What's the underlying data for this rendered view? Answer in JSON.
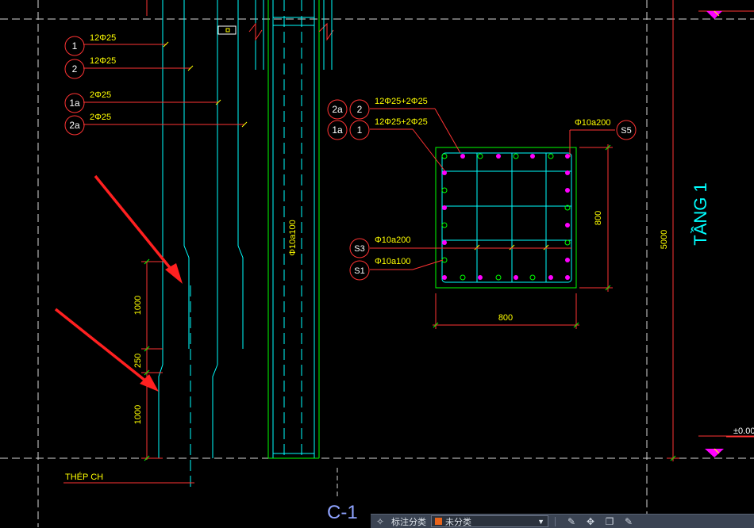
{
  "drawing": {
    "labels": {
      "bar_1": "1",
      "bar_2": "2",
      "bar_1a": "1a",
      "bar_2a": "2a",
      "bar_s1": "S1",
      "bar_s3": "S3",
      "bar_s5": "S5"
    },
    "rebar": {
      "left_1": "12Φ25",
      "left_2": "12Φ25",
      "left_1a": "2Φ25",
      "left_2a": "2Φ25",
      "section_2a_2": "12Φ25+2Φ25",
      "section_1a_1": "12Φ25+2Φ25",
      "stirrup_s5": "Φ10a200",
      "stirrup_s3": "Φ10a200",
      "stirrup_s1": "Φ10a100",
      "column_stirrup": "Φ10a100"
    },
    "dimensions": {
      "dim_1000_upper": "1000",
      "dim_250": "250",
      "dim_1000_lower": "1000",
      "section_width": "800",
      "section_height": "800",
      "level_height": "5000",
      "elevation": "±0.00"
    },
    "titles": {
      "thep_ch": "THÉP CH",
      "level_name": "TẦNG 1",
      "column_name": "C-1"
    }
  },
  "toolbar": {
    "label": "标注分类",
    "selected": "未分类",
    "accent_color": "#e8641b"
  }
}
